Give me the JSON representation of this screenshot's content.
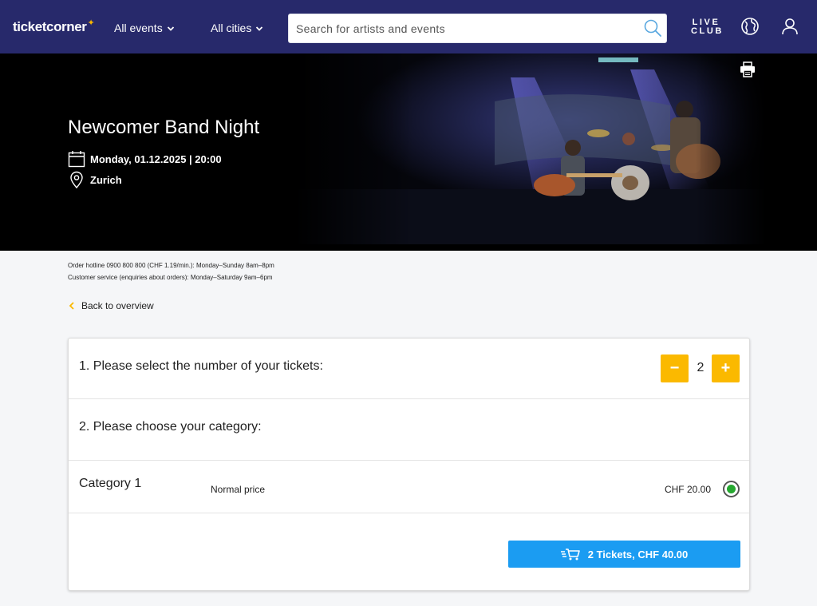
{
  "header": {
    "logo_text": "ticketcorner",
    "logo_star": "✦",
    "nav": [
      {
        "label": "All events"
      },
      {
        "label": "All cities"
      }
    ],
    "search": {
      "placeholder": "Search for artists and events",
      "value": ""
    },
    "live_club": {
      "line1": "LIVE",
      "line2": "CLUB"
    }
  },
  "event": {
    "title": "Newcomer Band Night",
    "datetime": "Monday, 01.12.2025 | 20:00",
    "location": "Zurich"
  },
  "info": {
    "hotline": "Order hotline 0900 800 800 (CHF 1.19/min.): Monday–Sunday 8am–8pm",
    "customer_service": "Customer service (enquiries about orders): Monday–Saturday 9am–6pm",
    "back_label": "Back to overview"
  },
  "booking": {
    "step1_label": "1. Please select the number of your tickets:",
    "quantity": "2",
    "minus_label": "−",
    "plus_label": "+",
    "step2_label": "2. Please choose your category:",
    "category": {
      "name": "Category 1",
      "price_type": "Normal price",
      "price": "CHF 20.00",
      "selected": true
    },
    "cart_label": "2 Tickets, CHF 40.00"
  },
  "colors": {
    "header_bg": "#27296b",
    "accent_yellow": "#fbb900",
    "cta_blue": "#1b9cf2",
    "selected_green": "#26a830"
  },
  "icons": {
    "search": "search-icon",
    "globe": "globe-icon",
    "user": "user-icon",
    "print": "print-icon",
    "calendar": "calendar-icon",
    "location": "location-pin-icon",
    "back": "chevron-left-icon",
    "cart": "cart-icon"
  }
}
